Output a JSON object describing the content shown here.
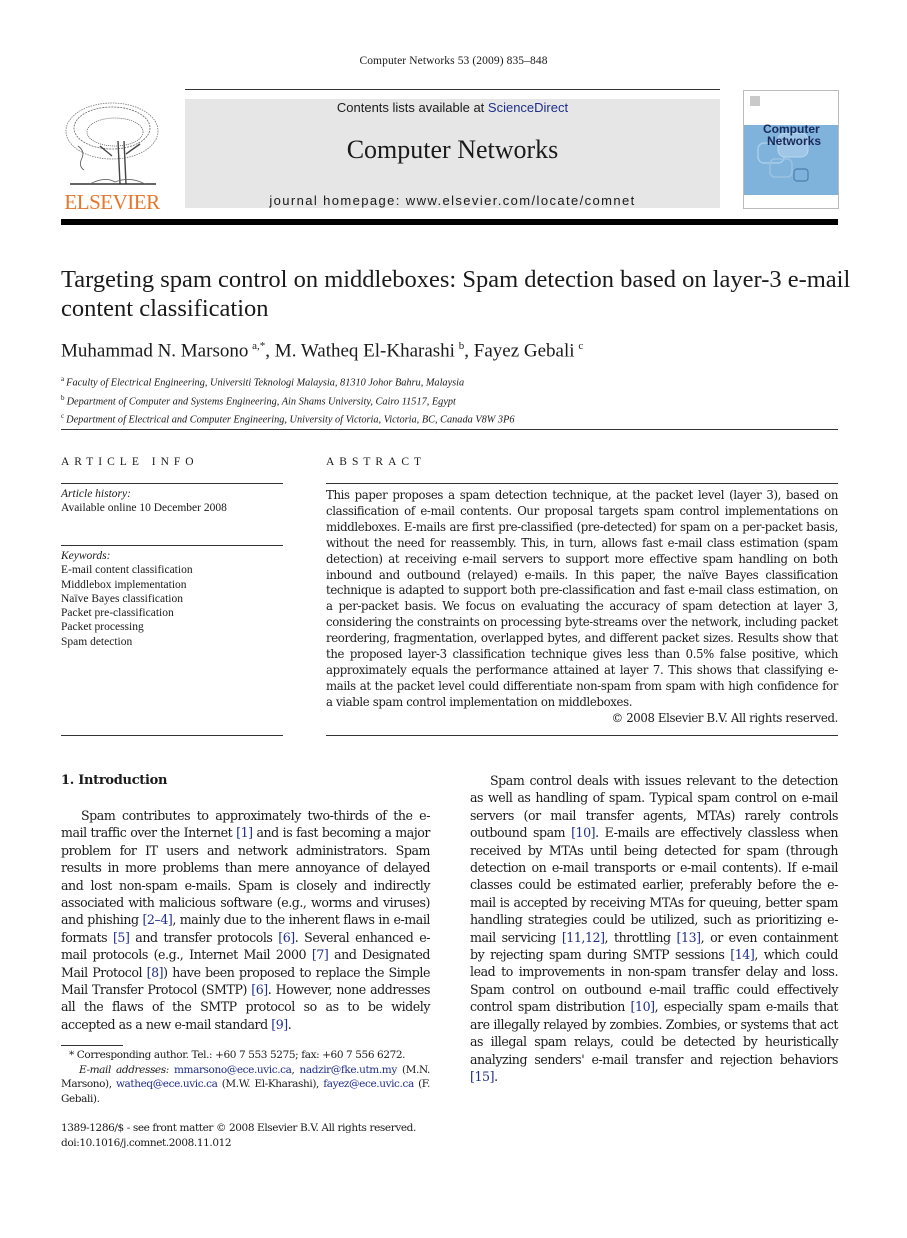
{
  "running_head": "Computer Networks 53 (2009) 835–848",
  "masthead": {
    "contents_prefix": "Contents lists available at ",
    "contents_link": "ScienceDirect",
    "journal_title": "Computer Networks",
    "homepage": "journal homepage: www.elsevier.com/locate/comnet",
    "publisher_logo_text": "ELSEVIER",
    "cover_line1": "Computer",
    "cover_line2": "Networks",
    "colors": {
      "publisher_orange": "#e8762b",
      "masthead_gray": "#e6e6e6",
      "link_blue": "#1f2d8a",
      "cover_blue": "#7fb3dc"
    }
  },
  "paper": {
    "title": "Targeting spam control on middleboxes: Spam detection based on layer-3 e-mail content classification",
    "authors": [
      {
        "name": "Muhammad N. Marsono",
        "sup": "a,*"
      },
      {
        "name": "M. Watheq El-Kharashi",
        "sup": "b"
      },
      {
        "name": "Fayez Gebali",
        "sup": "c"
      }
    ],
    "affiliations": [
      {
        "mark": "a",
        "text": "Faculty of Electrical Engineering, Universiti Teknologi Malaysia, 81310 Johor Bahru, Malaysia"
      },
      {
        "mark": "b",
        "text": "Department of Computer and Systems Engineering, Ain Shams University, Cairo 11517, Egypt"
      },
      {
        "mark": "c",
        "text": "Department of Electrical and Computer Engineering, University of Victoria, Victoria, BC, Canada V8W 3P6"
      }
    ]
  },
  "article_info": {
    "heading": "ARTICLE INFO",
    "history_label": "Article history:",
    "history_value": "Available online 10 December 2008",
    "keywords_label": "Keywords:",
    "keywords": [
      "E-mail content classification",
      "Middlebox implementation",
      "Naïve Bayes classification",
      "Packet pre-classification",
      "Packet processing",
      "Spam detection"
    ]
  },
  "abstract": {
    "heading": "ABSTRACT",
    "text": "This paper proposes a spam detection technique, at the packet level (layer 3), based on classification of e-mail contents. Our proposal targets spam control implementations on middleboxes. E-mails are first pre-classified (pre-detected) for spam on a per-packet basis, without the need for reassembly. This, in turn, allows fast e-mail class estimation (spam detection) at receiving e-mail servers to support more effective spam handling on both inbound and outbound (relayed) e-mails. In this paper, the naïve Bayes classification technique is adapted to support both pre-classification and fast e-mail class estimation, on a per-packet basis. We focus on evaluating the accuracy of spam detection at layer 3, considering the constraints on processing byte-streams over the network, including packet reordering, fragmentation, overlapped bytes, and different packet sizes. Results show that the proposed layer-3 classification technique gives less than 0.5% false positive, which approximately equals the performance attained at layer 7. This shows that classifying e-mails at the packet level could differentiate non-spam from spam with high confidence for a viable spam control implementation on middleboxes.",
    "copyright": "© 2008 Elsevier B.V. All rights reserved."
  },
  "introduction": {
    "heading": "1.  Introduction",
    "para1": [
      {
        "t": "Spam contributes to approximately two-thirds of the e-mail traffic over the Internet "
      },
      {
        "ref": "[1]"
      },
      {
        "t": " and is fast becoming a major problem for IT users and network administrators. Spam results in more problems than mere annoyance of delayed and lost non-spam e-mails. Spam is closely and indirectly associated with malicious software (e.g., worms and viruses) and phishing "
      },
      {
        "ref": "[2–4]"
      },
      {
        "t": ", mainly due to the inherent flaws in e-mail formats "
      },
      {
        "ref": "[5]"
      },
      {
        "t": " and transfer protocols "
      },
      {
        "ref": "[6]"
      },
      {
        "t": ". Several enhanced e-mail protocols (e.g., Internet Mail 2000 "
      },
      {
        "ref": "[7]"
      },
      {
        "t": " and Designated Mail Protocol "
      },
      {
        "ref": "[8]"
      },
      {
        "t": ") have been proposed to replace the Simple Mail Transfer Protocol (SMTP) "
      },
      {
        "ref": "[6]"
      },
      {
        "t": ". However, none addresses all the flaws of the SMTP protocol so as to be widely accepted as a new e-mail standard "
      },
      {
        "ref": "[9]"
      },
      {
        "t": "."
      }
    ],
    "para2": [
      {
        "t": "Spam control deals with issues relevant to the detection as well as handling of spam. Typical spam control on e-mail servers (or mail transfer agents, MTAs) rarely controls outbound spam "
      },
      {
        "ref": "[10]"
      },
      {
        "t": ". E-mails are effectively classless when received by MTAs until being detected for spam (through detection on e-mail transports or e-mail contents). If e-mail classes could be estimated earlier, preferably before the e-mail is accepted by receiving MTAs for queuing, better spam handling strategies could be utilized, such as prioritizing e-mail servicing "
      },
      {
        "ref": "[11,12]"
      },
      {
        "t": ", throttling "
      },
      {
        "ref": "[13]"
      },
      {
        "t": ", or even containment by rejecting spam during SMTP sessions "
      },
      {
        "ref": "[14]"
      },
      {
        "t": ", which could lead to improvements in non-spam transfer delay and loss. Spam control on outbound e-mail traffic could effectively control spam distribution "
      },
      {
        "ref": "[10]"
      },
      {
        "t": ", especially spam e-mails that are illegally relayed by zombies. Zombies, or systems that act as illegal spam relays, could be detected by heuristically analyzing senders' e-mail transfer and rejection behaviors "
      },
      {
        "ref": "[15]"
      },
      {
        "t": "."
      }
    ]
  },
  "footnote": {
    "corresponding": "* Corresponding author. Tel.: +60 7 553 5275; fax: +60 7 556 6272.",
    "email_label": "E-mail addresses:",
    "emails": [
      {
        "addr": "mmarsono@ece.uvic.ca",
        "after": ", "
      },
      {
        "addr": "nadzir@fke.utm.my",
        "after": " (M.N. Marsono), "
      },
      {
        "addr": "watheq@ece.uvic.ca",
        "after": " (M.W. El-Kharashi), "
      },
      {
        "addr": "fayez@ece.uvic.ca",
        "after": " (F. Gebali)."
      }
    ],
    "issn": "1389-1286/$ - see front matter © 2008 Elsevier B.V. All rights reserved.",
    "doi": "doi:10.1016/j.comnet.2008.11.012"
  }
}
